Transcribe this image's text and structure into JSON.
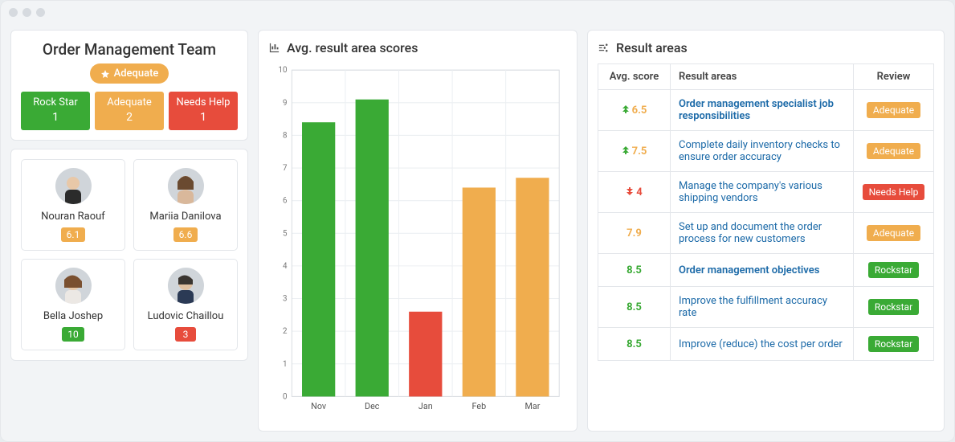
{
  "team": {
    "title": "Order Management Team",
    "overall_label": "Adequate",
    "stats": [
      {
        "label": "Rock Star",
        "count": "1",
        "color": "#3aaa35"
      },
      {
        "label": "Adequate",
        "count": "2",
        "color": "#f0ad4e"
      },
      {
        "label": "Needs Help",
        "count": "1",
        "color": "#e74c3c"
      }
    ],
    "people": [
      {
        "name": "Nouran Raouf",
        "score": "6.1",
        "badge_color": "#f0ad4e"
      },
      {
        "name": "Mariia Danilova",
        "score": "6.6",
        "badge_color": "#f0ad4e"
      },
      {
        "name": "Bella Joshep",
        "score": "10",
        "badge_color": "#3aaa35"
      },
      {
        "name": "Ludovic Chaillou",
        "score": "3",
        "badge_color": "#e74c3c"
      }
    ]
  },
  "chart_title": "Avg. result area scores",
  "chart_data": {
    "type": "bar",
    "title": "Avg. result area scores",
    "categories": [
      "Nov",
      "Dec",
      "Jan",
      "Feb",
      "Mar"
    ],
    "values": [
      8.4,
      9.1,
      2.6,
      6.4,
      6.7
    ],
    "colors": [
      "#3aaa35",
      "#3aaa35",
      "#e74c3c",
      "#f0ad4e",
      "#f0ad4e"
    ],
    "xlabel": "",
    "ylabel": "",
    "ylim": [
      0,
      10
    ],
    "y_ticks": [
      0,
      1,
      2,
      3,
      4,
      5,
      6,
      7,
      8,
      9,
      10
    ]
  },
  "results": {
    "title": "Result areas",
    "headers": {
      "score": "Avg. score",
      "area": "Result areas",
      "review": "Review"
    },
    "rows": [
      {
        "trend": "up",
        "score": "6.5",
        "score_class": "score6",
        "area": "Order management specialist job responsibilities",
        "bold": true,
        "review": "Adequate",
        "review_color": "#f0ad4e"
      },
      {
        "trend": "up",
        "score": "7.5",
        "score_class": "score7",
        "area": "Complete daily inventory checks to ensure order accuracy",
        "bold": false,
        "review": "Adequate",
        "review_color": "#f0ad4e"
      },
      {
        "trend": "down",
        "score": "4",
        "score_class": "score4",
        "area": "Manage the company's various shipping vendors",
        "bold": false,
        "review": "Needs Help",
        "review_color": "#e74c3c"
      },
      {
        "trend": "",
        "score": "7.9",
        "score_class": "score7",
        "area": "Set up and document the order process for new customers",
        "bold": false,
        "review": "Adequate",
        "review_color": "#f0ad4e"
      },
      {
        "trend": "",
        "score": "8.5",
        "score_class": "score8",
        "area": "Order management objectives",
        "bold": true,
        "review": "Rockstar",
        "review_color": "#3aaa35"
      },
      {
        "trend": "",
        "score": "8.5",
        "score_class": "score8",
        "area": "Improve the fulfillment accuracy rate",
        "bold": false,
        "review": "Rockstar",
        "review_color": "#3aaa35"
      },
      {
        "trend": "",
        "score": "8.5",
        "score_class": "score8",
        "area": "Improve (reduce) the cost per order",
        "bold": false,
        "review": "Rockstar",
        "review_color": "#3aaa35"
      }
    ]
  }
}
